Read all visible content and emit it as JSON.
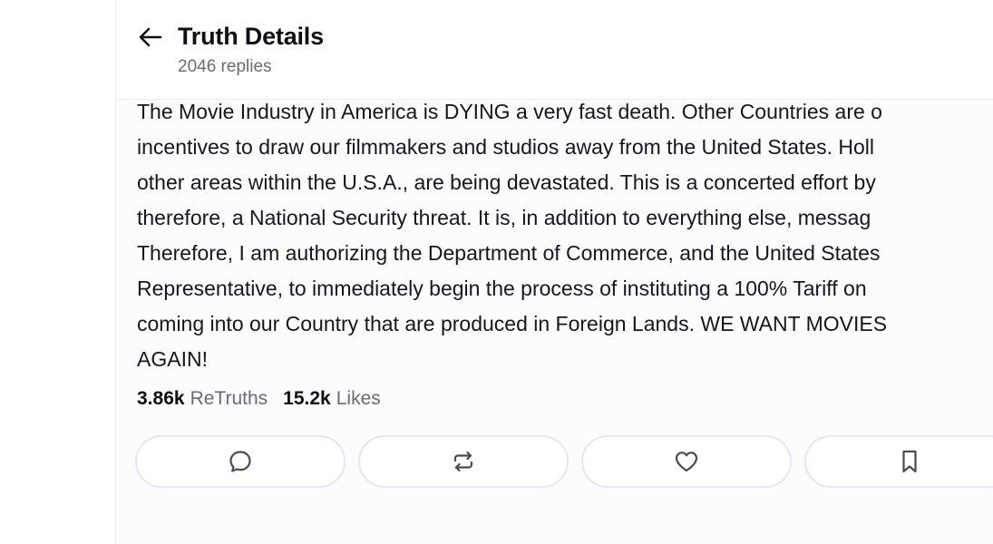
{
  "header": {
    "title": "Truth Details",
    "replies": "2046 replies",
    "back_icon": "arrow-left-icon"
  },
  "post": {
    "lines": [
      "The Movie Industry in America is DYING a very fast death. Other Countries are o",
      "incentives to draw our filmmakers and studios away from the United States. Holl",
      "other areas within the U.S.A., are being devastated. This is a concerted effort by",
      "therefore, a National Security threat. It is, in addition to everything else, messag",
      "Therefore, I am authorizing the Department of Commerce, and the United States",
      "Representative, to immediately begin the process of instituting a 100% Tariff on",
      "coming into our Country that are produced in Foreign Lands. WE WANT MOVIES",
      "AGAIN!"
    ]
  },
  "stats": {
    "retruths_count": "3.86k",
    "retruths_label": "ReTruths",
    "likes_count": "15.2k",
    "likes_label": "Likes"
  },
  "actions": [
    {
      "name": "reply",
      "icon": "comment-icon"
    },
    {
      "name": "retruth",
      "icon": "repost-icon"
    },
    {
      "name": "like",
      "icon": "heart-icon"
    },
    {
      "name": "bookmark",
      "icon": "bookmark-icon"
    }
  ],
  "colors": {
    "text": "#0f0f14",
    "muted": "#6b6b74",
    "border": "#e8e6ee",
    "icon": "#4a4a55"
  }
}
